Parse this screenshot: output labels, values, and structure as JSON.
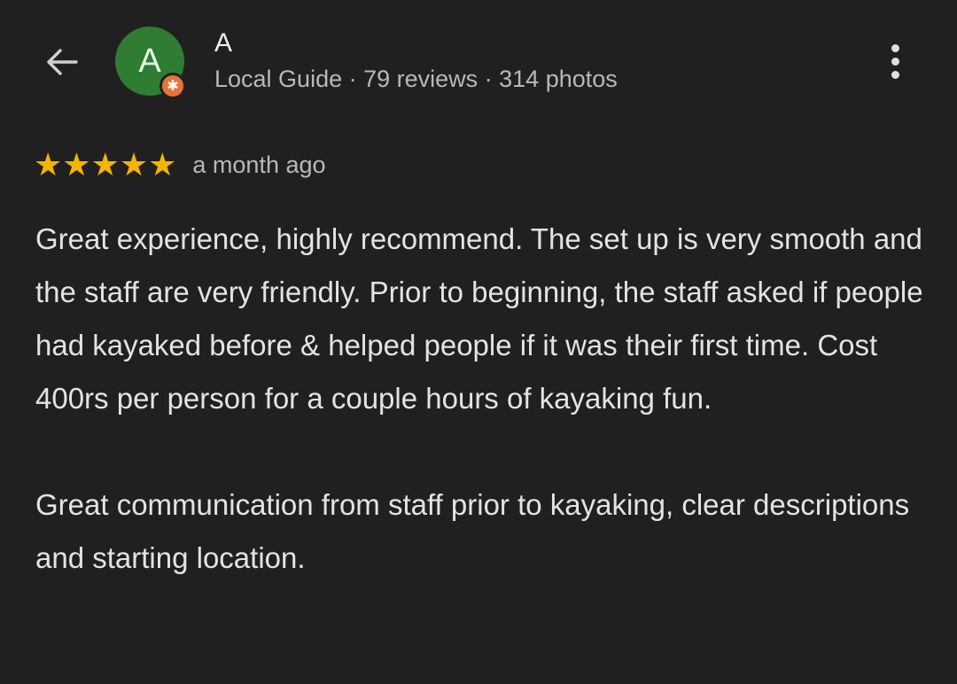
{
  "header": {
    "back_icon": "arrow-left-icon",
    "avatar_letter": "A",
    "badge_icon": "local-guide-star-icon",
    "badge_color": "#e8733a",
    "avatar_color": "#2e7d32",
    "user_name": "A",
    "user_meta": "Local Guide · 79 reviews · 314 photos",
    "menu_icon": "more-vert-icon"
  },
  "review": {
    "rating": 5,
    "rating_max": 5,
    "star_color": "#f4b400",
    "date": "a month ago",
    "paragraphs": [
      "Great experience, highly recommend. The set up is very smooth and the staff are very friendly. Prior to beginning, the staff asked if people had kayaked before & helped people if it was their first time. Cost 400rs per person for a couple hours of kayaking fun.",
      "Great communication from staff prior to kayaking, clear descriptions and starting location."
    ]
  }
}
